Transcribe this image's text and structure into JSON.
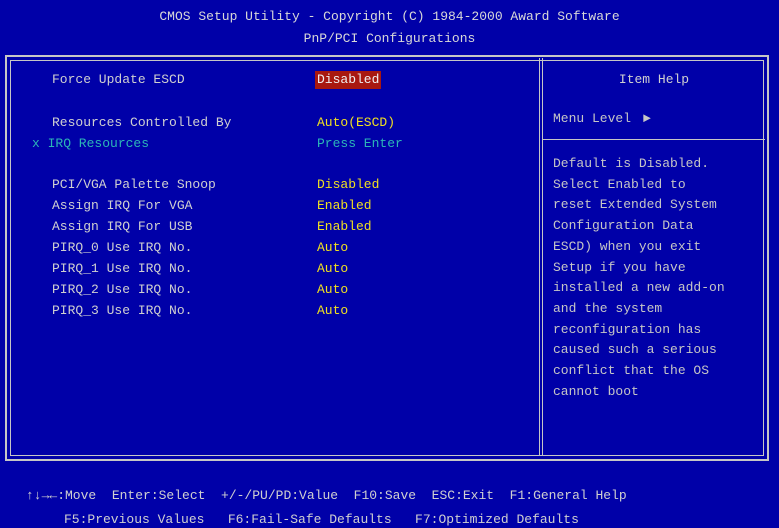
{
  "header": {
    "title": "CMOS Setup Utility - Copyright (C) 1984-2000 Award Software",
    "subtitle": "PnP/PCI Configurations"
  },
  "settings": [
    {
      "label": "Force Update ESCD",
      "value": "Disabled"
    },
    {
      "label": "Resources Controlled By",
      "value": "Auto(ESCD)"
    },
    {
      "label": "x IRQ Resources",
      "value": "Press Enter"
    },
    {
      "label": "PCI/VGA Palette Snoop",
      "value": "Disabled"
    },
    {
      "label": "Assign IRQ For VGA",
      "value": "Enabled"
    },
    {
      "label": "Assign IRQ For USB",
      "value": "Enabled"
    },
    {
      "label": "PIRQ_0 Use IRQ No.",
      "value": "Auto"
    },
    {
      "label": "PIRQ_1 Use IRQ No.",
      "value": "Auto"
    },
    {
      "label": "PIRQ_2 Use IRQ No.",
      "value": "Auto"
    },
    {
      "label": "PIRQ_3 Use IRQ No.",
      "value": "Auto"
    }
  ],
  "help": {
    "title": "Item Help",
    "menu_level": "Menu Level",
    "menu_arrow": "►",
    "text": "Default is Disabled.\nSelect Enabled to\nreset Extended System\nConfiguration Data\nESCD) when you exit\nSetup if you have\ninstalled a new add-on\nand the system\nreconfiguration has\ncaused such a serious\nconflict that the OS\ncannot boot"
  },
  "footer": {
    "line1": "↑↓→←:Move  Enter:Select  +/-/PU/PD:Value  F10:Save  ESC:Exit  F1:General Help",
    "line2": "F5:Previous Values   F6:Fail-Safe Defaults   F7:Optimized Defaults"
  },
  "colors": {
    "background": "#0000a8",
    "value": "#f0e020",
    "disabled": "#2cb6b6",
    "selected_bg": "#a81810"
  }
}
